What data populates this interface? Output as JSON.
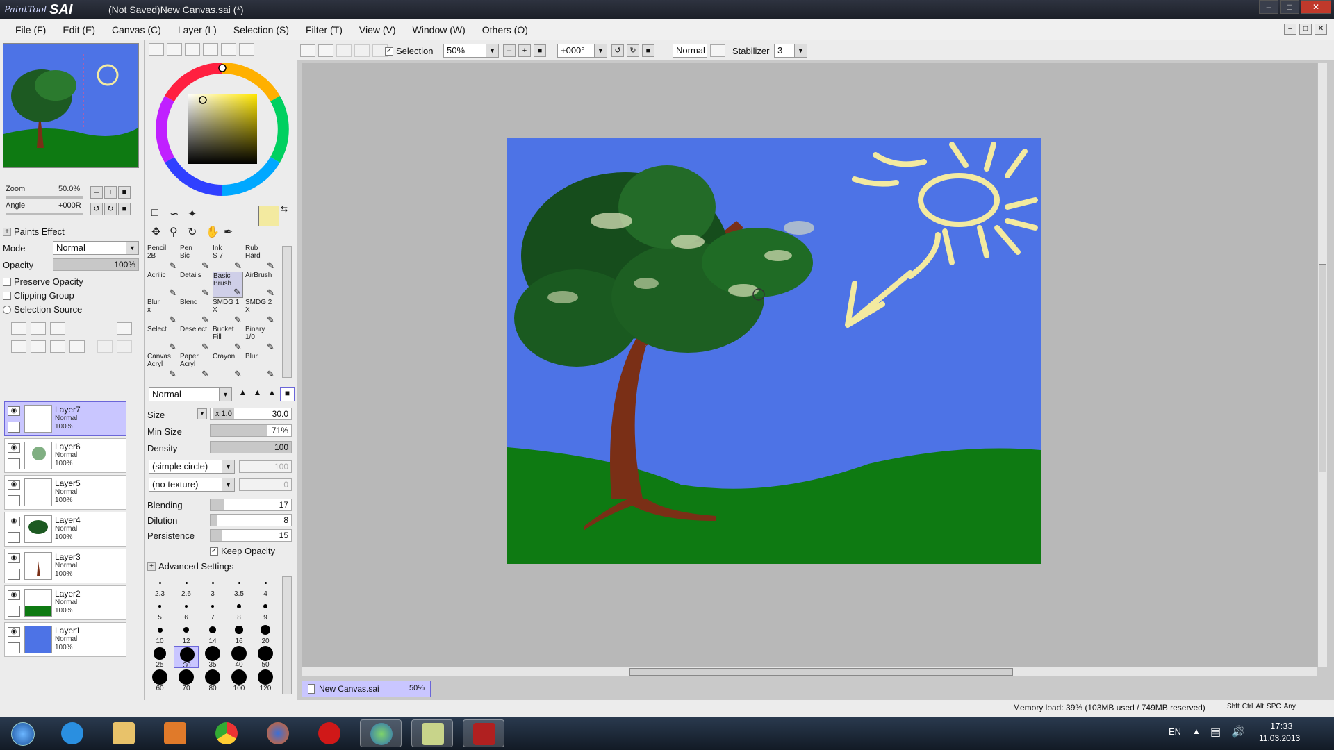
{
  "window": {
    "app_logo_small": "PaintTool",
    "app_logo_big": "SAI",
    "title": "(Not Saved)New Canvas.sai (*)"
  },
  "menu": [
    "File (F)",
    "Edit (E)",
    "Canvas (C)",
    "Layer (L)",
    "Selection (S)",
    "Filter (T)",
    "View (V)",
    "Window (W)",
    "Others (O)"
  ],
  "navigator": {
    "zoom_label": "Zoom",
    "zoom_value": "50.0%",
    "angle_label": "Angle",
    "angle_value": "+000R"
  },
  "layer_props": {
    "paints_effect": "Paints Effect",
    "mode_label": "Mode",
    "mode_value": "Normal",
    "opacity_label": "Opacity",
    "opacity_value": "100%",
    "opacity_level": 1.0,
    "preserve_opacity": "Preserve Opacity",
    "clipping_group": "Clipping Group",
    "selection_source": "Selection Source"
  },
  "layers": [
    {
      "name": "Layer7",
      "mode": "Normal",
      "opacity": "100%",
      "selected": true
    },
    {
      "name": "Layer6",
      "mode": "Normal",
      "opacity": "100%",
      "selected": false
    },
    {
      "name": "Layer5",
      "mode": "Normal",
      "opacity": "100%",
      "selected": false
    },
    {
      "name": "Layer4",
      "mode": "Normal",
      "opacity": "100%",
      "selected": false
    },
    {
      "name": "Layer3",
      "mode": "Normal",
      "opacity": "100%",
      "selected": false
    },
    {
      "name": "Layer2",
      "mode": "Normal",
      "opacity": "100%",
      "selected": false
    },
    {
      "name": "Layer1",
      "mode": "Normal",
      "opacity": "100%",
      "selected": false
    }
  ],
  "colors": {
    "primary": "#f3eaa0",
    "secondary": "#404040",
    "sky": "#4d73e6",
    "grass": "#0e7a12",
    "trunk": "#7a2f16",
    "sun": "#f3eaa0"
  },
  "brushes": [
    [
      "Pencil\n2B",
      "Pen\nBic",
      "Ink\nS 7",
      "Rub\nHard"
    ],
    [
      "Acrilic",
      "Details",
      "Basic\nBrush",
      "AirBrush"
    ],
    [
      "Blur\nx",
      "Blend",
      "SMDG 1\nX",
      "SMDG 2\nX"
    ],
    [
      "Select",
      "Deselect",
      "Bucket\nFill",
      "Binary\n1/0"
    ],
    [
      "Canvas\nAcryl",
      "Paper\nAcryl",
      "Crayon",
      "Blur"
    ]
  ],
  "brush_settings": {
    "blend_mode": "Normal",
    "size_label": "Size",
    "size_mult": "x 1.0",
    "size_value": "30.0",
    "min_size_label": "Min Size",
    "min_size_value": "71%",
    "min_size_level": 0.71,
    "density_label": "Density",
    "density_value": "100",
    "density_level": 1.0,
    "shape": "(simple circle)",
    "shape_value": "100",
    "texture": "(no texture)",
    "texture_value": "0",
    "blending_label": "Blending",
    "blending_value": "17",
    "blending_level": 0.17,
    "dilution_label": "Dilution",
    "dilution_value": "8",
    "dilution_level": 0.08,
    "persistence_label": "Persistence",
    "persistence_value": "15",
    "persistence_level": 0.15,
    "keep_opacity": "Keep Opacity",
    "advanced_settings": "Advanced Settings"
  },
  "size_presets": [
    "2.3",
    "2.6",
    "3",
    "3.5",
    "4",
    "5",
    "6",
    "7",
    "8",
    "9",
    "10",
    "12",
    "14",
    "16",
    "20",
    "25",
    "30",
    "35",
    "40",
    "50",
    "60",
    "70",
    "80",
    "100",
    "120"
  ],
  "selected_size": "30",
  "canvas_toolbar": {
    "selection_label": "Selection",
    "zoom": "50%",
    "rotation": "+000°",
    "blend": "Normal",
    "stabilizer_label": "Stabilizer",
    "stabilizer_value": "3"
  },
  "document_tab": {
    "name": "New Canvas.sai",
    "zoom": "50%"
  },
  "status": {
    "memory": "Memory load: 39% (103MB used / 749MB reserved)",
    "keys": [
      "Shft",
      "Ctrl",
      "Alt",
      "SPC",
      "Any"
    ]
  },
  "taskbar": {
    "language": "EN",
    "time": "17:33",
    "date": "11.03.2013"
  }
}
